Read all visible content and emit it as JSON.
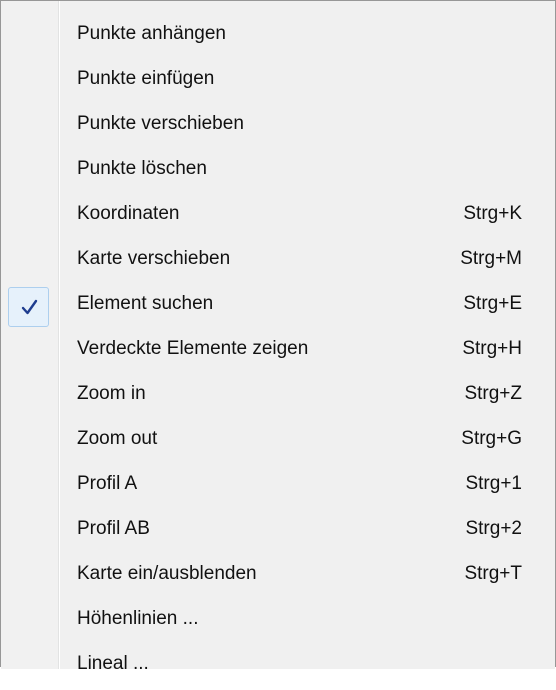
{
  "menu": {
    "items": [
      {
        "label": "Punkte anhängen",
        "shortcut": "",
        "checked": false
      },
      {
        "label": "Punkte einfügen",
        "shortcut": "",
        "checked": false
      },
      {
        "label": "Punkte verschieben",
        "shortcut": "",
        "checked": false
      },
      {
        "label": "Punkte löschen",
        "shortcut": "",
        "checked": false
      },
      {
        "label": "Koordinaten",
        "shortcut": "Strg+K",
        "checked": false
      },
      {
        "label": "Karte verschieben",
        "shortcut": "Strg+M",
        "checked": false
      },
      {
        "label": "Element suchen",
        "shortcut": "Strg+E",
        "checked": true
      },
      {
        "label": "Verdeckte Elemente zeigen",
        "shortcut": "Strg+H",
        "checked": false
      },
      {
        "label": "Zoom in",
        "shortcut": "Strg+Z",
        "checked": false
      },
      {
        "label": "Zoom out",
        "shortcut": "Strg+G",
        "checked": false
      },
      {
        "label": "Profil A",
        "shortcut": "Strg+1",
        "checked": false
      },
      {
        "label": "Profil AB",
        "shortcut": "Strg+2",
        "checked": false
      },
      {
        "label": "Karte ein/ausblenden",
        "shortcut": "Strg+T",
        "checked": false
      },
      {
        "label": "Höhenlinien ...",
        "shortcut": "",
        "checked": false
      },
      {
        "label": "Lineal ...",
        "shortcut": "",
        "checked": false
      }
    ],
    "check_icon": "checkmark-icon",
    "colors": {
      "background": "#f0f0f0",
      "check_highlight": "#e6f1fb",
      "check_border": "#adcfee",
      "check_mark": "#1f3d8f"
    }
  }
}
